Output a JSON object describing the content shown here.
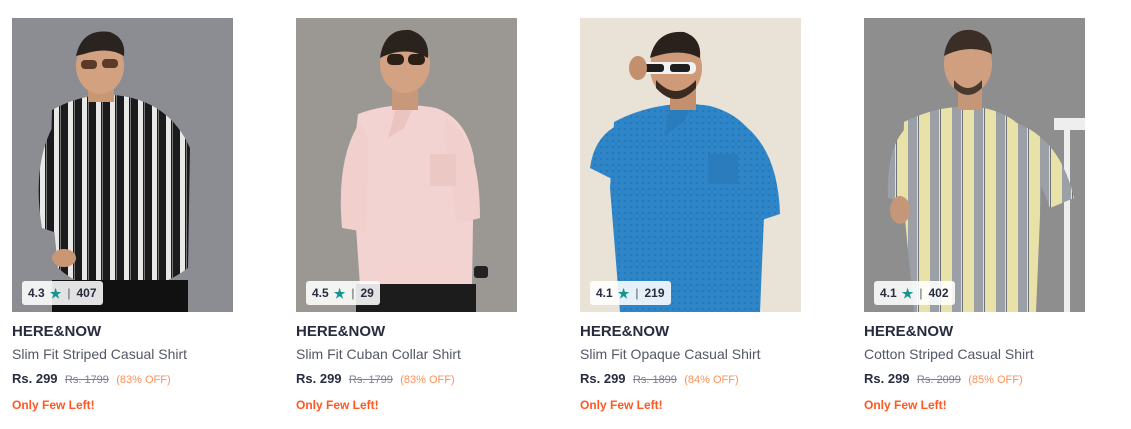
{
  "products": [
    {
      "brand": "HERE&NOW",
      "title": "Slim Fit Striped Casual Shirt",
      "price": "Rs. 299",
      "mrp": "Rs. 1799",
      "discount": "(83% OFF)",
      "stock": "Only Few Left!",
      "rating": "4.3",
      "rating_count": "407",
      "bg": "#8b8d93",
      "shirt": "stripes-bw"
    },
    {
      "brand": "HERE&NOW",
      "title": "Slim Fit Cuban Collar Shirt",
      "price": "Rs. 299",
      "mrp": "Rs. 1799",
      "discount": "(83% OFF)",
      "stock": "Only Few Left!",
      "rating": "4.5",
      "rating_count": "29",
      "bg": "#9b9894",
      "shirt": "pink"
    },
    {
      "brand": "HERE&NOW",
      "title": "Slim Fit Opaque Casual Shirt",
      "price": "Rs. 299",
      "mrp": "Rs. 1899",
      "discount": "(84% OFF)",
      "stock": "Only Few Left!",
      "rating": "4.1",
      "rating_count": "219",
      "bg": "#e9e2d6",
      "shirt": "blue"
    },
    {
      "brand": "HERE&NOW",
      "title": "Cotton Striped Casual Shirt",
      "price": "Rs. 299",
      "mrp": "Rs. 2099",
      "discount": "(85% OFF)",
      "stock": "Only Few Left!",
      "rating": "4.1",
      "rating_count": "402",
      "bg": "#8e8e8f",
      "shirt": "stripes-yellow"
    }
  ],
  "colors": {
    "rating_star": "#14958f",
    "discount": "#ff905a",
    "stock": "#ff5722"
  }
}
